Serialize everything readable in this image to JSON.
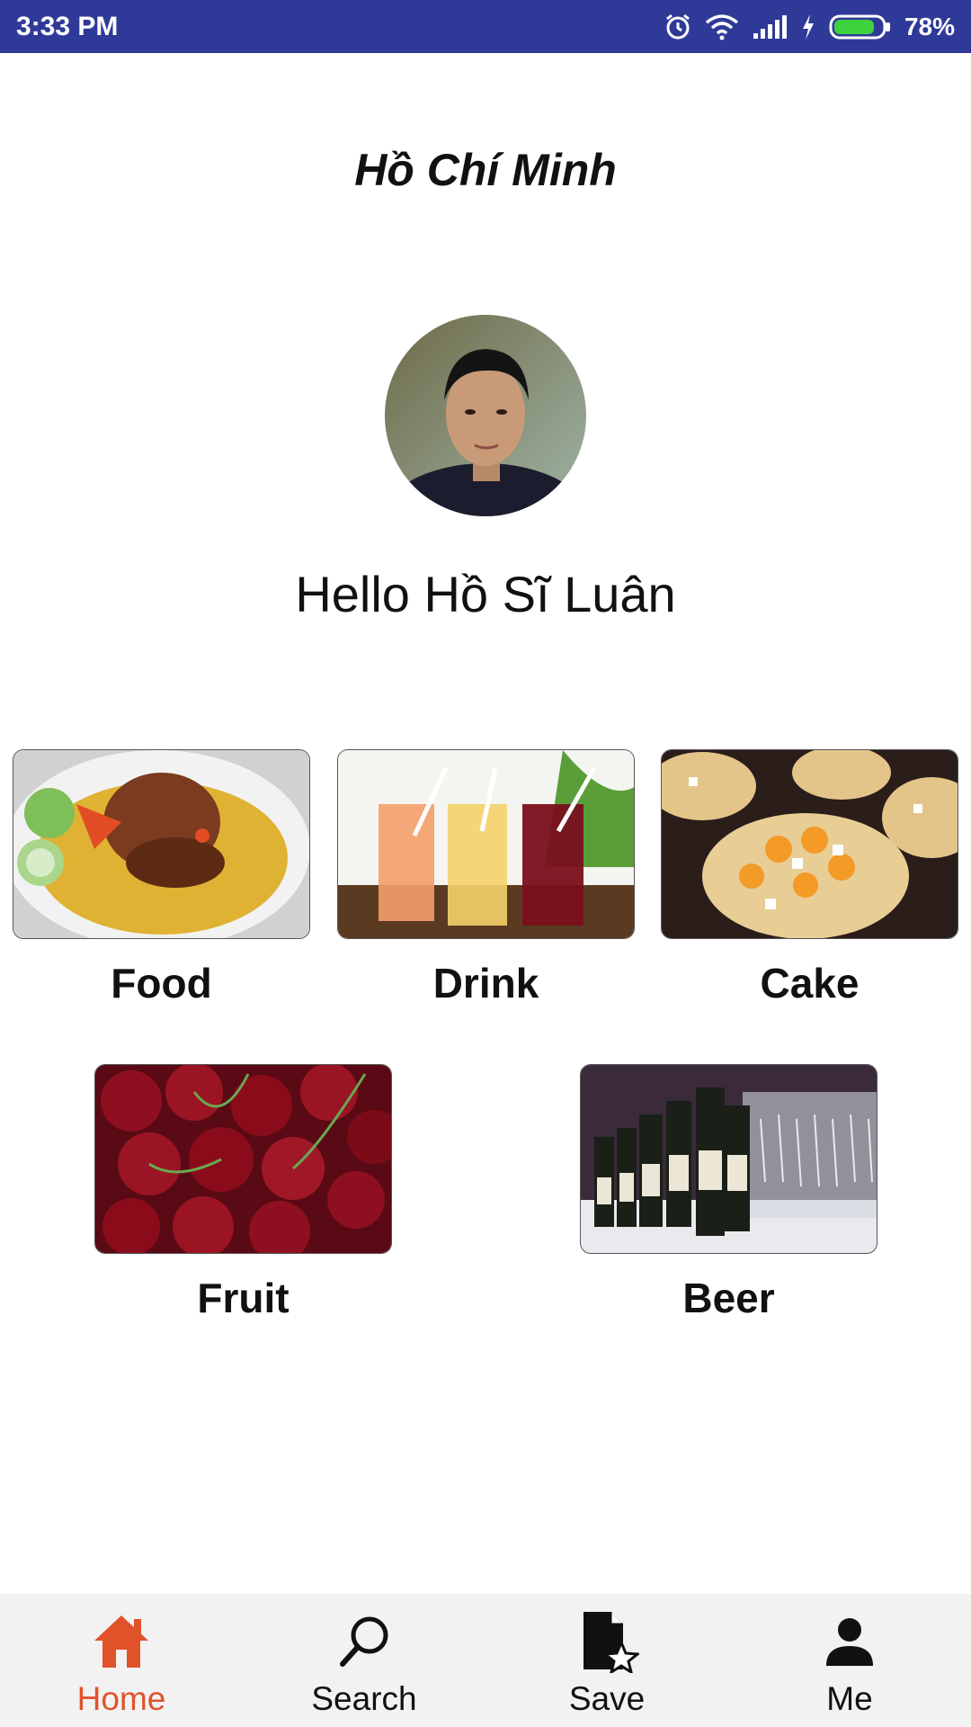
{
  "status_bar": {
    "time": "3:33 PM",
    "battery": "78%",
    "icons": [
      "alarm-icon",
      "wifi-icon",
      "signal-icon",
      "charging-icon",
      "battery-icon"
    ]
  },
  "location": "Hồ Chí Minh",
  "greeting": "Hello Hồ Sĩ Luân",
  "categories": [
    {
      "label": "Food"
    },
    {
      "label": "Drink"
    },
    {
      "label": "Cake"
    },
    {
      "label": "Fruit"
    },
    {
      "label": "Beer"
    }
  ],
  "bottom_nav": {
    "active": "Home",
    "active_color": "#e0532a",
    "items": [
      {
        "label": "Home",
        "icon": "home-icon"
      },
      {
        "label": "Search",
        "icon": "search-icon"
      },
      {
        "label": "Save",
        "icon": "save-document-icon"
      },
      {
        "label": "Me",
        "icon": "person-icon"
      }
    ]
  },
  "colors": {
    "status_bar": "#2f3a98",
    "nav_background": "#f2f2f2",
    "accent": "#e0532a"
  }
}
